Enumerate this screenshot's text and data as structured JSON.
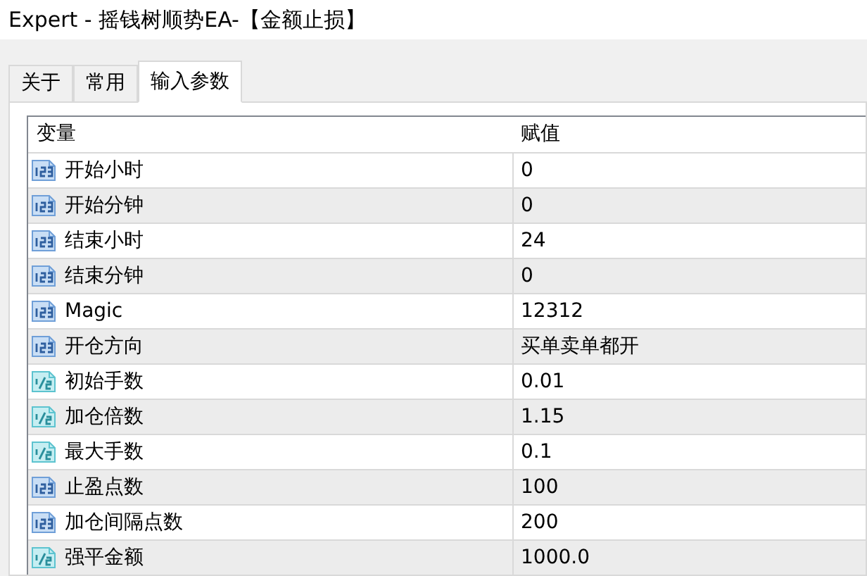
{
  "window": {
    "title": "Expert - 摇钱树顺势EA-【金额止损】"
  },
  "tabs": [
    {
      "label": "关于",
      "selected": false
    },
    {
      "label": "常用",
      "selected": false
    },
    {
      "label": "输入参数",
      "selected": true
    }
  ],
  "table": {
    "columns": [
      "变量",
      "赋值"
    ],
    "rows": [
      {
        "kind": "int",
        "name": "开始小时",
        "value": "0"
      },
      {
        "kind": "int",
        "name": "开始分钟",
        "value": "0"
      },
      {
        "kind": "int",
        "name": "结束小时",
        "value": "24"
      },
      {
        "kind": "int",
        "name": "结束分钟",
        "value": "0"
      },
      {
        "kind": "int",
        "name": "Magic",
        "value": "12312"
      },
      {
        "kind": "int",
        "name": "开仓方向",
        "value": "买单卖单都开"
      },
      {
        "kind": "double",
        "name": "初始手数",
        "value": "0.01"
      },
      {
        "kind": "double",
        "name": "加仓倍数",
        "value": "1.15"
      },
      {
        "kind": "double",
        "name": "最大手数",
        "value": "0.1"
      },
      {
        "kind": "int",
        "name": "止盈点数",
        "value": "100"
      },
      {
        "kind": "int",
        "name": "加仓间隔点数",
        "value": "200"
      },
      {
        "kind": "double",
        "name": "强平金额",
        "value": "1000.0"
      }
    ]
  }
}
